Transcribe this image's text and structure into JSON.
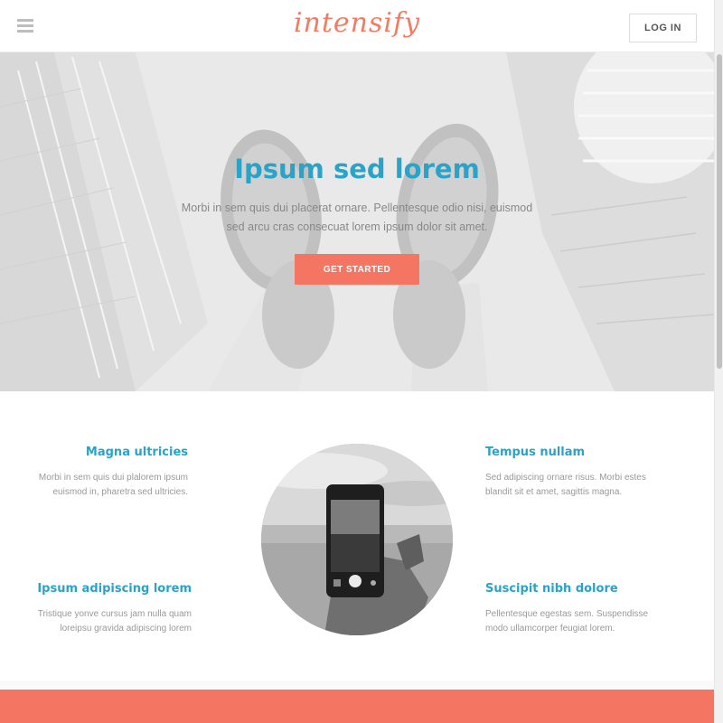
{
  "header": {
    "logo": "intensify",
    "login_label": "LOG IN",
    "menu_icon": "hamburger-icon"
  },
  "hero": {
    "title": "Ipsum sed lorem",
    "text": "Morbi in sem quis dui placerat ornare. Pellentesque odio nisi, euismod sed arcu cras consecuat lorem ipsum dolor sit amet.",
    "cta_label": "GET STARTED"
  },
  "features": [
    {
      "title": "Magna ultricies",
      "text": "Morbi in sem quis dui plalorem ipsum euismod in, pharetra sed ultricies."
    },
    {
      "title": "Ipsum adipiscing lorem",
      "text": "Tristique yonve cursus jam nulla quam loreipsu gravida adipiscing lorem"
    },
    {
      "title": "Tempus nullam",
      "text": "Sed adipiscing ornare risus. Morbi estes blandit sit et amet, sagittis magna."
    },
    {
      "title": "Suscipit nibh dolore",
      "text": "Pellentesque egestas sem. Suspendisse modo ullamcorper feugiat lorem."
    }
  ],
  "colors": {
    "accent": "#f47561",
    "heading": "#2aa3c8",
    "logo": "#f47b62"
  }
}
